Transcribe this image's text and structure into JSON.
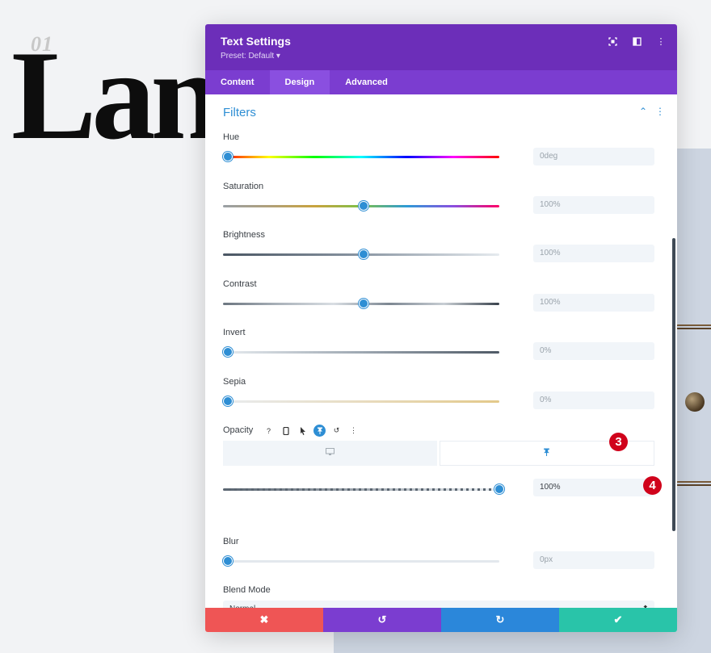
{
  "background": {
    "number": "01",
    "word": "Lan"
  },
  "modal": {
    "title": "Text Settings",
    "preset": "Preset: Default ▾",
    "header_icons": [
      "focus-icon",
      "split-view-icon",
      "more-icon"
    ],
    "tabs": [
      {
        "label": "Content",
        "active": false
      },
      {
        "label": "Design",
        "active": true
      },
      {
        "label": "Advanced",
        "active": false
      }
    ],
    "section_title": "Filters",
    "filters": {
      "hue": {
        "label": "Hue",
        "value": "0deg",
        "level": 0
      },
      "saturation": {
        "label": "Saturation",
        "value": "100%",
        "level": 0.5
      },
      "brightness": {
        "label": "Brightness",
        "value": "100%",
        "level": 0.5
      },
      "contrast": {
        "label": "Contrast",
        "value": "100%",
        "level": 0.5
      },
      "invert": {
        "label": "Invert",
        "value": "0%",
        "level": 0
      },
      "sepia": {
        "label": "Sepia",
        "value": "0%",
        "level": 0
      },
      "opacity": {
        "label": "Opacity",
        "value": "100%",
        "level": 1
      },
      "blur": {
        "label": "Blur",
        "value": "0px",
        "level": 0
      }
    },
    "opacity_icons": [
      "help-icon",
      "mobile-icon",
      "cursor-icon",
      "pin-icon",
      "reset-icon",
      "more-icon"
    ],
    "device_tabs": [
      {
        "icon": "desktop-icon",
        "active": false
      },
      {
        "icon": "pin-icon",
        "active": true
      }
    ],
    "badges": {
      "three": "3",
      "four": "4"
    },
    "blend_mode": {
      "label": "Blend Mode",
      "value": "Normal"
    },
    "footer": {
      "cancel": "✖",
      "undo": "↺",
      "redo": "↻",
      "save": "✔"
    },
    "colors": {
      "header": "#6c2eb9",
      "tabs": "#7b3dd0",
      "accent": "#2e8ed4",
      "cancel": "#ef5555",
      "redo": "#2b87da",
      "save": "#29c4a9",
      "badge": "#d0021b"
    }
  }
}
